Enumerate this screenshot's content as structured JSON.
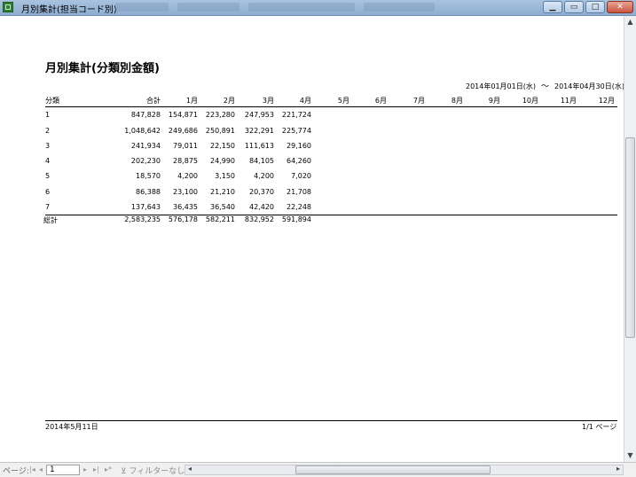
{
  "window": {
    "title": "月別集計(担当コード別)",
    "icon": "access-report-icon"
  },
  "report": {
    "title": "月別集計(分類別金額)",
    "date_from": "2014年01月01日(水)",
    "date_tilde": "～",
    "date_to": "2014年04月30日(水)",
    "columns": [
      "分類",
      "合計",
      "1月",
      "2月",
      "3月",
      "4月",
      "5月",
      "6月",
      "7月",
      "8月",
      "9月",
      "10月",
      "11月",
      "12月"
    ],
    "rows": [
      {
        "cat": "1",
        "total": "847,828",
        "m1": "154,871",
        "m2": "223,280",
        "m3": "247,953",
        "m4": "221,724"
      },
      {
        "cat": "2",
        "total": "1,048,642",
        "m1": "249,686",
        "m2": "250,891",
        "m3": "322,291",
        "m4": "225,774"
      },
      {
        "cat": "3",
        "total": "241,934",
        "m1": "79,011",
        "m2": "22,150",
        "m3": "111,613",
        "m4": "29,160"
      },
      {
        "cat": "4",
        "total": "202,230",
        "m1": "28,875",
        "m2": "24,990",
        "m3": "84,105",
        "m4": "64,260"
      },
      {
        "cat": "5",
        "total": "18,570",
        "m1": "4,200",
        "m2": "3,150",
        "m3": "4,200",
        "m4": "7,020"
      },
      {
        "cat": "6",
        "total": "86,388",
        "m1": "23,100",
        "m2": "21,210",
        "m3": "20,370",
        "m4": "21,708"
      },
      {
        "cat": "7",
        "total": "137,643",
        "m1": "36,435",
        "m2": "36,540",
        "m3": "42,420",
        "m4": "22,248"
      }
    ],
    "grand_total": {
      "label": "総計",
      "total": "2,583,235",
      "m1": "576,178",
      "m2": "582,211",
      "m3": "832,952",
      "m4": "591,894"
    },
    "footer_date": "2014年5月11日",
    "footer_page": "1/1 ページ"
  },
  "statusbar": {
    "page_label": "ページ:",
    "page_value": "1",
    "filter_label": "フィルターなし"
  }
}
